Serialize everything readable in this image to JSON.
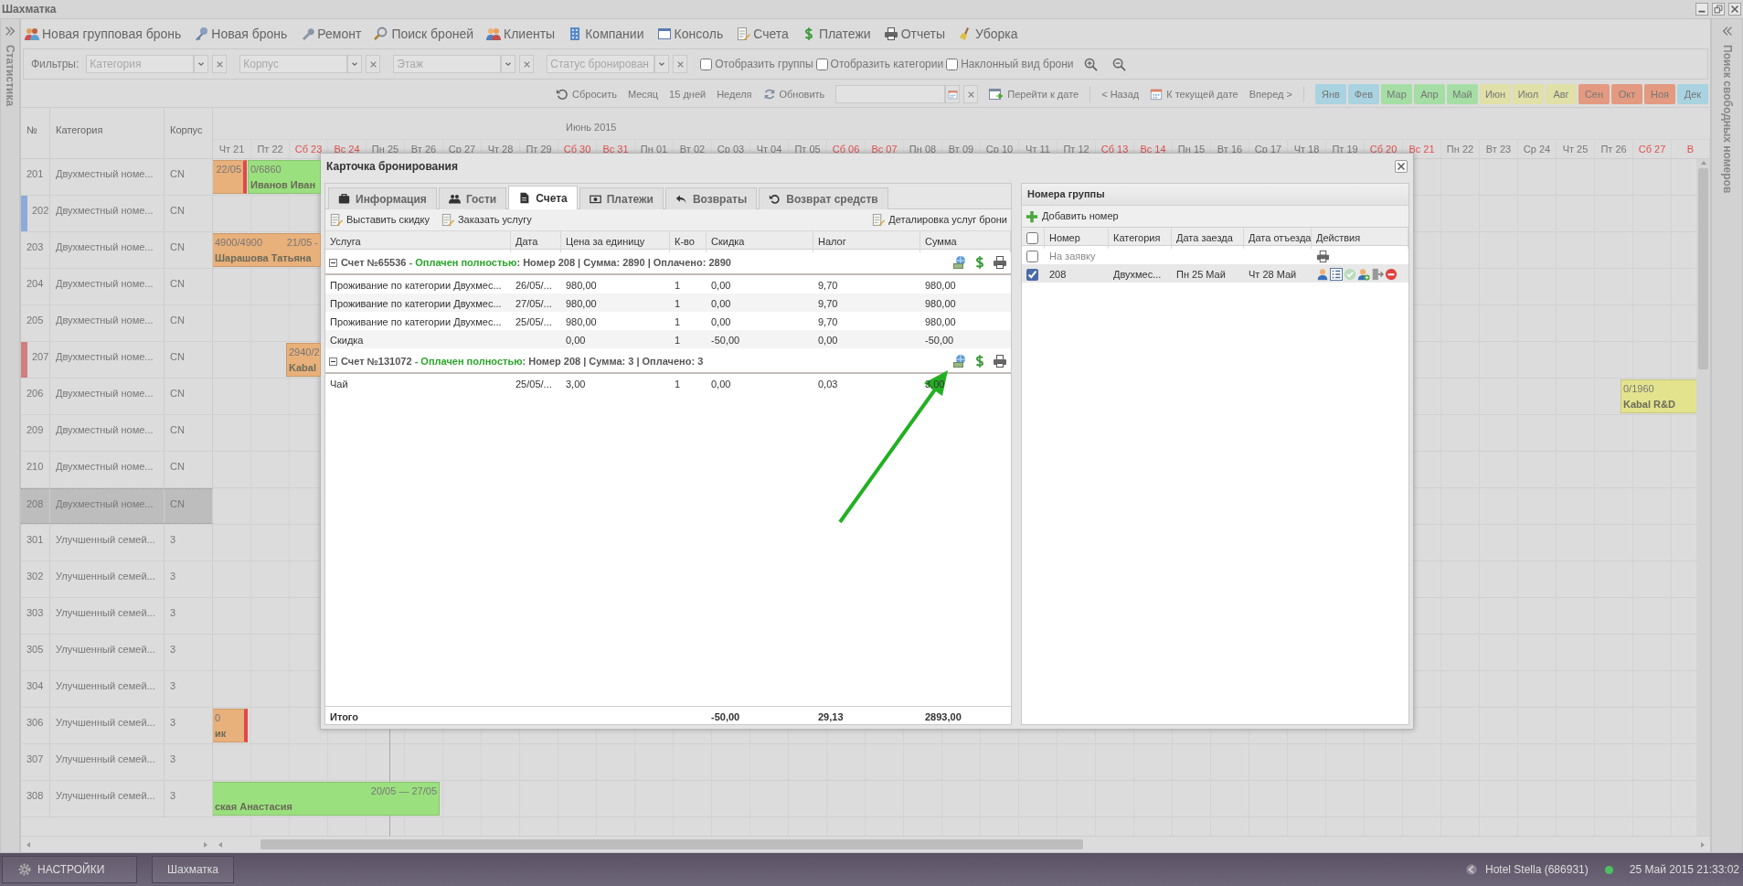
{
  "window": {
    "title": "Шахматка"
  },
  "left_panel": {
    "title": "Статистика"
  },
  "right_panel": {
    "title": "Поиск свободных номеров"
  },
  "toolbar": [
    {
      "label": "Новая групповая бронь"
    },
    {
      "label": "Новая бронь"
    },
    {
      "label": "Ремонт"
    },
    {
      "label": "Поиск броней"
    },
    {
      "label": "Клиенты"
    },
    {
      "label": "Компании"
    },
    {
      "label": "Консоль"
    },
    {
      "label": "Счета"
    },
    {
      "label": "Платежи"
    },
    {
      "label": "Отчеты"
    },
    {
      "label": "Уборка"
    }
  ],
  "filters": {
    "label": "Фильтры:",
    "selects": [
      {
        "placeholder": "Категория"
      },
      {
        "placeholder": "Корпус"
      },
      {
        "placeholder": "Этаж"
      },
      {
        "placeholder": "Статус бронирован"
      }
    ],
    "checkboxes": [
      {
        "label": "Отобразить группы",
        "checked": false
      },
      {
        "label": "Отобразить категории",
        "checked": false
      },
      {
        "label": "Наклонный вид брони",
        "checked": false
      }
    ]
  },
  "controls": {
    "reset": "Сбросить",
    "views": [
      "Месяц",
      "15 дней",
      "Неделя"
    ],
    "refresh": "Обновить",
    "goto": "Перейти к дате",
    "back": "< Назад",
    "today": "К текущей дате",
    "forward": "Вперед >",
    "months": [
      {
        "label": "Янв",
        "color": "#a9d3e0"
      },
      {
        "label": "Фев",
        "color": "#a9d3e0"
      },
      {
        "label": "Мар",
        "color": "#a5dea5"
      },
      {
        "label": "Апр",
        "color": "#a5dea5"
      },
      {
        "label": "Май",
        "color": "#a5dea5"
      },
      {
        "label": "Июн",
        "color": "#e0e0a8"
      },
      {
        "label": "Июл",
        "color": "#e0e0a8"
      },
      {
        "label": "Авг",
        "color": "#e0e0a8"
      },
      {
        "label": "Сен",
        "color": "#e39a80"
      },
      {
        "label": "Окт",
        "color": "#e39a80"
      },
      {
        "label": "Ноя",
        "color": "#e39a80"
      },
      {
        "label": "Дек",
        "color": "#a9d3e0"
      }
    ]
  },
  "grid": {
    "columns": [
      "№",
      "Категория",
      "Корпус"
    ],
    "month": "Июнь 2015",
    "days": [
      {
        "label": "Чт 21",
        "weekend": false
      },
      {
        "label": "Пт 22",
        "weekend": false
      },
      {
        "label": "Сб 23",
        "weekend": true
      },
      {
        "label": "Вс 24",
        "weekend": true
      },
      {
        "label": "Пн 25",
        "weekend": false
      },
      {
        "label": "Вт 26",
        "weekend": false
      },
      {
        "label": "Ср 27",
        "weekend": false
      },
      {
        "label": "Чт 28",
        "weekend": false
      },
      {
        "label": "Пт 29",
        "weekend": false
      },
      {
        "label": "Сб 30",
        "weekend": true
      },
      {
        "label": "Вс 31",
        "weekend": true
      },
      {
        "label": "Пн 01",
        "weekend": false
      },
      {
        "label": "Вт 02",
        "weekend": false
      },
      {
        "label": "Ср 03",
        "weekend": false
      },
      {
        "label": "Чт 04",
        "weekend": false
      },
      {
        "label": "Пт 05",
        "weekend": false
      },
      {
        "label": "Сб 06",
        "weekend": true
      },
      {
        "label": "Вс 07",
        "weekend": true
      },
      {
        "label": "Пн 08",
        "weekend": false
      },
      {
        "label": "Вт 09",
        "weekend": false
      },
      {
        "label": "Ср 10",
        "weekend": false
      },
      {
        "label": "Чт 11",
        "weekend": false
      },
      {
        "label": "Пт 12",
        "weekend": false
      },
      {
        "label": "Сб 13",
        "weekend": true
      },
      {
        "label": "Вс 14",
        "weekend": true
      },
      {
        "label": "Пн 15",
        "weekend": false
      },
      {
        "label": "Вт 16",
        "weekend": false
      },
      {
        "label": "Ср 17",
        "weekend": false
      },
      {
        "label": "Чт 18",
        "weekend": false
      },
      {
        "label": "Пт 19",
        "weekend": false
      },
      {
        "label": "Сб 20",
        "weekend": true
      },
      {
        "label": "Вс 21",
        "weekend": true
      },
      {
        "label": "Пн 22",
        "weekend": false
      },
      {
        "label": "Вт 23",
        "weekend": false
      },
      {
        "label": "Ср 24",
        "weekend": false
      },
      {
        "label": "Чт 25",
        "weekend": false
      },
      {
        "label": "Пт 26",
        "weekend": false
      },
      {
        "label": "Сб 27",
        "weekend": true
      },
      {
        "label": "В",
        "weekend": true
      }
    ],
    "rooms": [
      {
        "number": "201",
        "category": "Двухместный номе...",
        "building": "CN",
        "selected": false,
        "bookings": [
          {
            "dates": "22/05",
            "color": "#e8b07a",
            "end_marker": true
          },
          {
            "amount": "0/6860",
            "guest": "Иванов Иван",
            "color": "#9be07e",
            "end_marker": false
          }
        ]
      },
      {
        "number": "202",
        "category": "Двухместный номе...",
        "building": "CN",
        "selected": false,
        "color": "#8eaadb"
      },
      {
        "number": "203",
        "category": "Двухместный номе...",
        "building": "CN",
        "selected": false,
        "bookings": [
          {
            "amount": "4900/4900",
            "dates": "21/05 -",
            "guest": "Шарашова Татьяна",
            "color": "#e8b07a",
            "end_marker": false
          }
        ]
      },
      {
        "number": "204",
        "category": "Двухместный номе...",
        "building": "CN",
        "selected": false
      },
      {
        "number": "205",
        "category": "Двухместный номе...",
        "building": "CN",
        "selected": false
      },
      {
        "number": "207",
        "category": "Двухместный номе...",
        "building": "CN",
        "selected": false,
        "color": "#d08080",
        "bookings": [
          {
            "amount": "2940/2",
            "guest": "Kabal",
            "color": "#e8b07a",
            "end_marker": false
          }
        ]
      },
      {
        "number": "206",
        "category": "Двухместный номе...",
        "building": "CN",
        "selected": false,
        "bookings": [
          {
            "amount": "0/1960",
            "guest": "Kabal R&D",
            "color": "#e3e38e",
            "end_marker": false
          }
        ]
      },
      {
        "number": "209",
        "category": "Двухместный номе...",
        "building": "CN",
        "selected": false
      },
      {
        "number": "210",
        "category": "Двухместный номе...",
        "building": "CN",
        "selected": false
      },
      {
        "number": "208",
        "category": "Двухместный номе...",
        "building": "CN",
        "selected": true
      },
      {
        "number": "301",
        "category": "Улучшенный семей...",
        "building": "3",
        "selected": false
      },
      {
        "number": "302",
        "category": "Улучшенный семей...",
        "building": "3",
        "selected": false
      },
      {
        "number": "303",
        "category": "Улучшенный семей...",
        "building": "3",
        "selected": false
      },
      {
        "number": "305",
        "category": "Улучшенный семей...",
        "building": "3",
        "selected": false
      },
      {
        "number": "304",
        "category": "Улучшенный семей...",
        "building": "3",
        "selected": false
      },
      {
        "number": "306",
        "category": "Улучшенный семей...",
        "building": "3",
        "selected": false,
        "bookings": [
          {
            "amount": "0",
            "guest": "ик",
            "color": "#e8b07a",
            "end_marker": true
          }
        ]
      },
      {
        "number": "307",
        "category": "Улучшенный семей...",
        "building": "3",
        "selected": false
      },
      {
        "number": "308",
        "category": "Улучшенный семей...",
        "building": "3",
        "selected": false,
        "bookings": [
          {
            "dates": "20/05 — 27/05",
            "guest": "ская Анастасия",
            "color": "#9be07e",
            "end_marker": false
          }
        ]
      }
    ]
  },
  "dialog": {
    "title": "Карточка бронирования",
    "tabs": [
      {
        "label": "Информация",
        "selected": false
      },
      {
        "label": "Гости",
        "selected": false
      },
      {
        "label": "Счета",
        "selected": true
      },
      {
        "label": "Платежи",
        "selected": false
      },
      {
        "label": "Возвраты",
        "selected": false
      },
      {
        "label": "Возврат средств",
        "selected": false
      }
    ],
    "actions": [
      "Выставить скидку",
      "Заказать услугу"
    ],
    "detail_action": "Деталировка услуг брони",
    "columns": [
      "Услуга",
      "Дата",
      "Цена за единицу",
      "К-во",
      "Скидка",
      "Налог",
      "Сумма"
    ],
    "invoices": [
      {
        "title": "Счет №65536",
        "status": "- Оплачен полностью",
        "details": ": Номер 208 | Сумма: 2890 | Оплачено: 2890",
        "expanded": true,
        "rows": [
          {
            "service": "Проживание по категории Двухмес...",
            "date": "26/05/...",
            "price": "980,00",
            "qty": "1",
            "discount": "0,00",
            "tax": "9,70",
            "sum": "980,00"
          },
          {
            "service": "Проживание по категории Двухмес...",
            "date": "27/05/...",
            "price": "980,00",
            "qty": "1",
            "discount": "0,00",
            "tax": "9,70",
            "sum": "980,00"
          },
          {
            "service": "Проживание по категории Двухмес...",
            "date": "25/05/...",
            "price": "980,00",
            "qty": "1",
            "discount": "0,00",
            "tax": "9,70",
            "sum": "980,00"
          },
          {
            "service": "Скидка",
            "price": "0,00",
            "qty": "1",
            "discount": "-50,00",
            "tax": "0,00",
            "sum": "-50,00"
          }
        ]
      },
      {
        "title": "Счет №131072",
        "status": "- Оплачен полностью",
        "details": ": Номер 208 | Сумма: 3 | Оплачено: 3",
        "expanded": true,
        "rows": [
          {
            "service": "Чай",
            "date": "25/05/...",
            "price": "3,00",
            "qty": "1",
            "discount": "0,00",
            "tax": "0,03",
            "sum": "3,00"
          }
        ]
      }
    ],
    "total": {
      "label": "Итого",
      "discount": "-50,00",
      "tax": "29,13",
      "sum": "2893,00"
    },
    "group": {
      "title": "Номера группы",
      "add": "Добавить номер",
      "columns": [
        "Номер",
        "Категория",
        "Дата заезда",
        "Дата отъезда",
        "Действия"
      ],
      "all_checked": false,
      "rows": [
        {
          "kind": "request",
          "number": "На заявку",
          "checked": false
        },
        {
          "kind": "room",
          "number": "208",
          "category": "Двухмес...",
          "arrival": "Пн 25 Май",
          "departure": "Чт 28 Май",
          "checked": true
        }
      ]
    }
  },
  "taskbar": {
    "settings": "НАСТРОЙКИ",
    "window": "Шахматка",
    "hotel": "Hotel Stella (686931)",
    "datetime": "25 Май 2015 21:33:02"
  }
}
